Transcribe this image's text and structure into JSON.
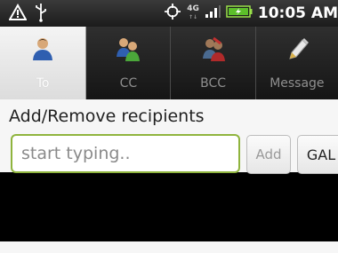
{
  "status_bar": {
    "network_label": "4G",
    "time": "10:05 AM",
    "icons": [
      "warning-icon",
      "usb-icon",
      "gps-icon",
      "signal-icon",
      "battery-icon"
    ]
  },
  "tabs": [
    {
      "label": "To",
      "icon": "person-icon",
      "active": true
    },
    {
      "label": "CC",
      "icon": "people-icon",
      "active": false
    },
    {
      "label": "BCC",
      "icon": "hidden-people-icon",
      "active": false
    },
    {
      "label": "Message",
      "icon": "pencil-icon",
      "active": false
    }
  ],
  "recipients": {
    "title": "Add/Remove recipients",
    "input_placeholder": "start typing..",
    "input_value": "",
    "add_label": "Add",
    "gal_label": "GAL"
  },
  "colors": {
    "accent_green": "#8fb43e",
    "active_tab": "#eaeaea",
    "inactive_tab": "#222222"
  }
}
